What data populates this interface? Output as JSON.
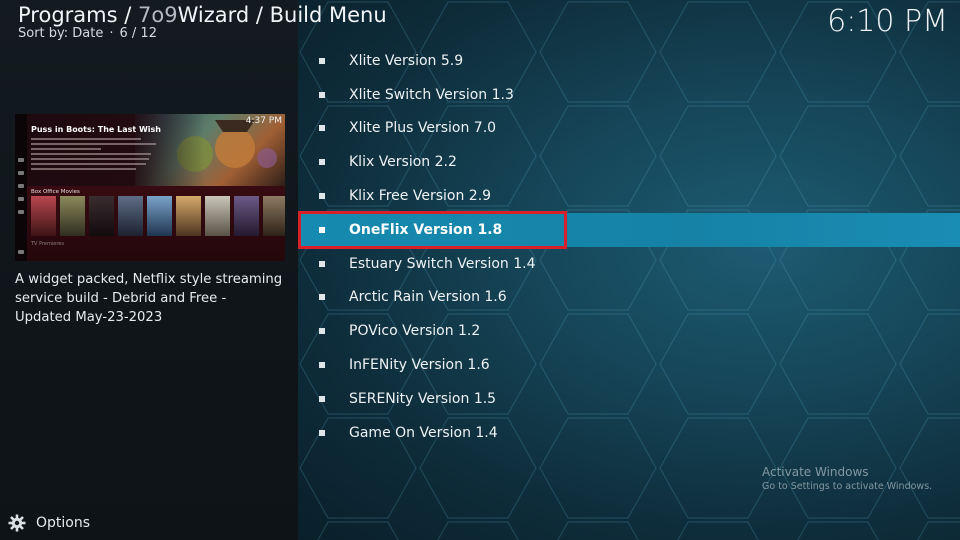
{
  "header": {
    "breadcrumb_prefix": "Programs /",
    "breadcrumb_addon": "7o9",
    "breadcrumb_suffix": "Wizard / Build Menu",
    "sort_label": "Sort by: Date",
    "position": "6 / 12",
    "clock": "6:10 PM"
  },
  "preview": {
    "thumb_title": "Puss in Boots: The Last Wish",
    "thumb_clock": "4:37 PM",
    "thumb_section": "Box Office Movies",
    "description": "A widget packed, Netflix style streaming service build - Debrid and Free - Updated May-23-2023"
  },
  "menu": {
    "selected_index": 5,
    "items": [
      {
        "label": "Xlite Version 5.9"
      },
      {
        "label": "Xlite Switch Version 1.3"
      },
      {
        "label": "Xlite Plus Version 7.0"
      },
      {
        "label": "Klix Version 2.2"
      },
      {
        "label": "Klix Free Version 2.9"
      },
      {
        "label": "OneFlix Version 1.8"
      },
      {
        "label": "Estuary Switch Version 1.4"
      },
      {
        "label": "Arctic Rain Version 1.6"
      },
      {
        "label": "POVico Version 1.2"
      },
      {
        "label": "InFENity Version 1.6"
      },
      {
        "label": "SERENity Version 1.5"
      },
      {
        "label": "Game On Version 1.4"
      }
    ]
  },
  "footer": {
    "options_label": "Options",
    "options_icon": "gear-icon"
  },
  "watermark": {
    "line1": "Activate Windows",
    "line2": "Go to Settings to activate Windows."
  },
  "colors": {
    "selected_row": "#168ab0",
    "highlight_border": "#d8202b",
    "background_right": "#154456",
    "background_left": "#11181c"
  }
}
